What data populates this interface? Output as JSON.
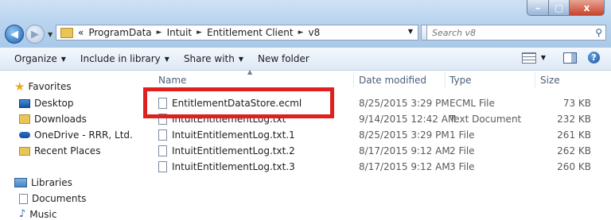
{
  "window": {
    "min_glyph": "–",
    "max_glyph": "▢",
    "close_glyph": "x"
  },
  "address_bar": {
    "overflow": "«",
    "crumbs": [
      "ProgramData",
      "Intuit",
      "Entitlement Client",
      "v8"
    ],
    "separator": "►"
  },
  "search": {
    "placeholder": "Search v8"
  },
  "toolbar": {
    "organize": "Organize",
    "include": "Include in library",
    "share": "Share with",
    "new_folder": "New folder"
  },
  "navigation": {
    "favorites": "Favorites",
    "desktop": "Desktop",
    "downloads": "Downloads",
    "onedrive": "OneDrive - RRR, Ltd.",
    "recent": "Recent Places",
    "libraries": "Libraries",
    "documents": "Documents",
    "music": "Music"
  },
  "columns": {
    "name": "Name",
    "date": "Date modified",
    "type": "Type",
    "size": "Size"
  },
  "files": [
    {
      "name": "EntitlementDataStore.ecml",
      "date": "8/25/2015 3:29 PM",
      "type": "ECML File",
      "size": "73 KB"
    },
    {
      "name": "IntuitEntitlementLog.txt",
      "date": "9/14/2015 12:42 AM",
      "type": "Text Document",
      "size": "232 KB"
    },
    {
      "name": "IntuitEntitlementLog.txt.1",
      "date": "8/25/2015 3:29 PM",
      "type": "1 File",
      "size": "261 KB"
    },
    {
      "name": "IntuitEntitlementLog.txt.2",
      "date": "8/17/2015 9:12 AM",
      "type": "2 File",
      "size": "262 KB"
    },
    {
      "name": "IntuitEntitlementLog.txt.3",
      "date": "8/17/2015 9:12 AM",
      "type": "3 File",
      "size": "260 KB"
    }
  ],
  "colors": {
    "highlight": "#e0201f",
    "titlebar": "#b9d4ef"
  }
}
